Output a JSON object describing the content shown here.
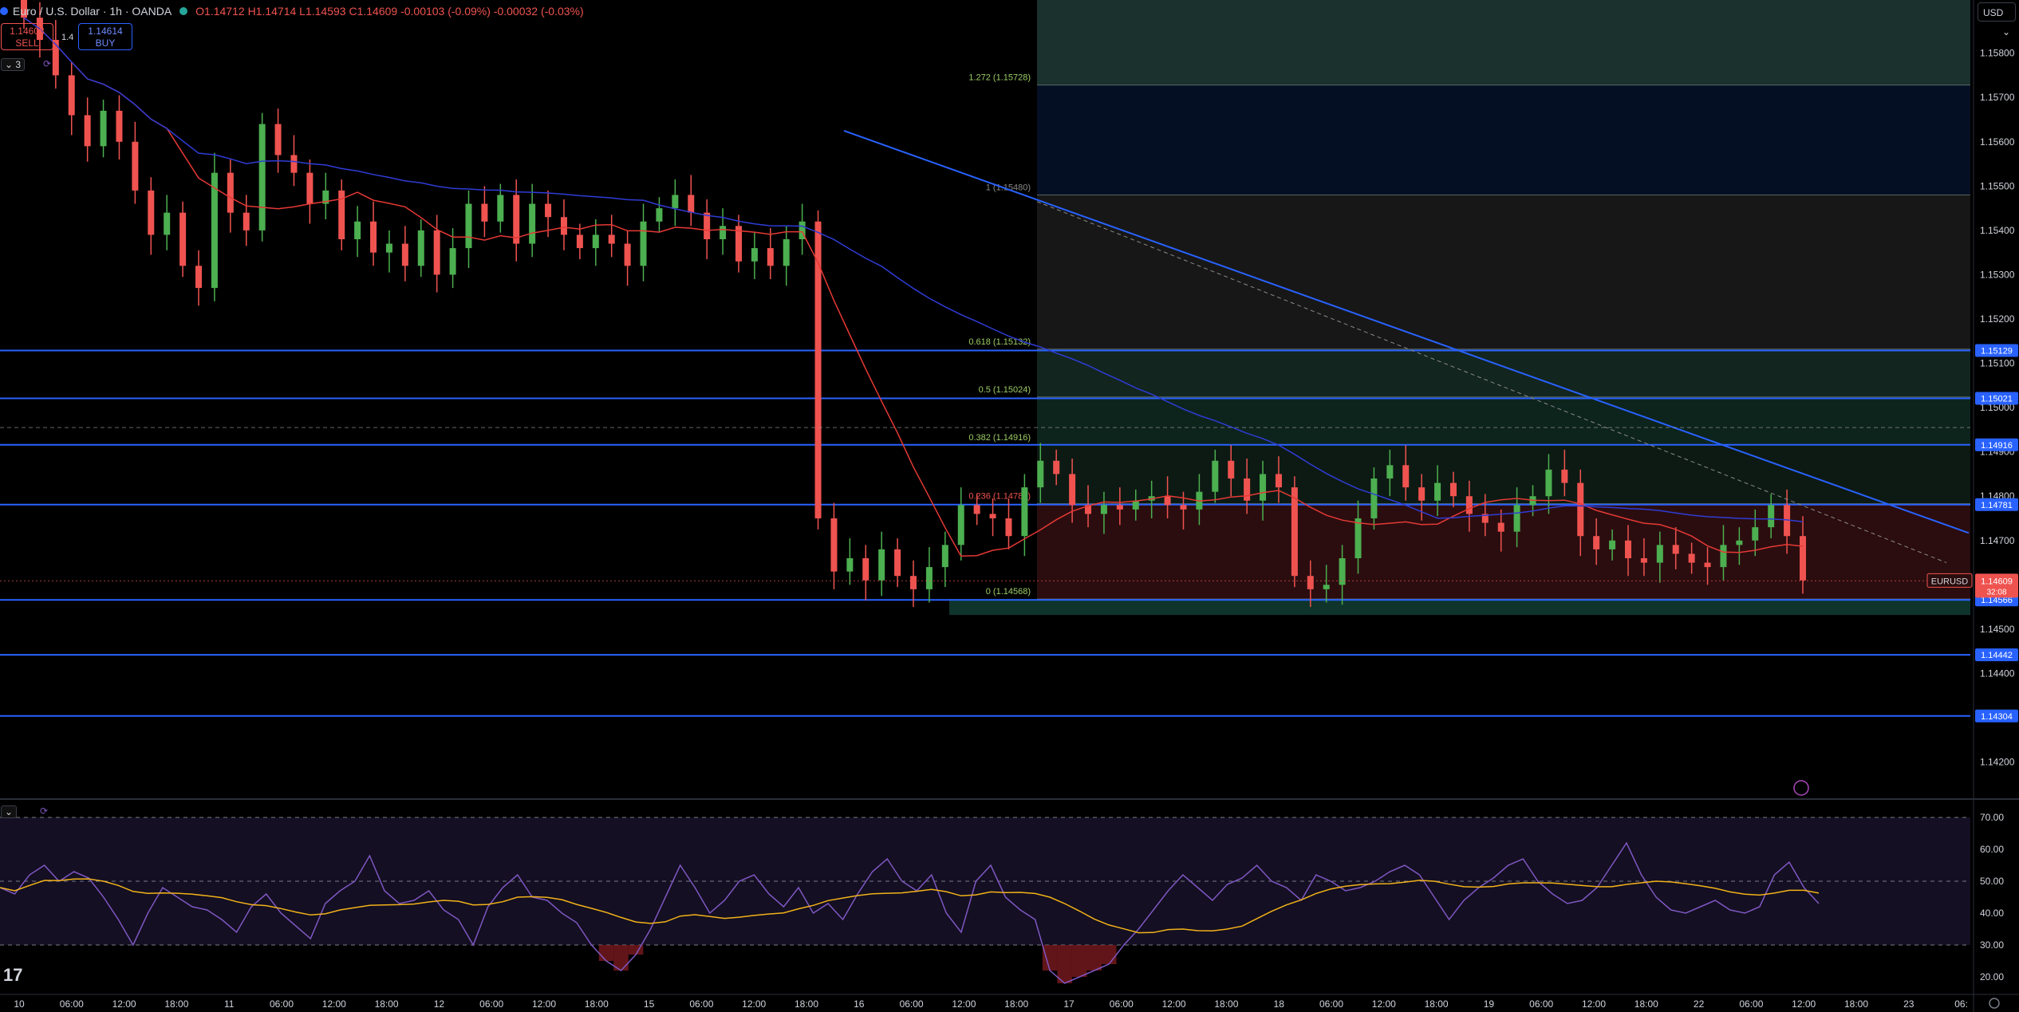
{
  "header": {
    "symbol": "Euro / U.S. Dollar · 1h · OANDA",
    "open": "O1.14712",
    "high": "H1.14714",
    "low": "L1.14593",
    "close": "C1.14609",
    "change": "-0.00103 (-0.09%)",
    "change2": "-0.00032 (-0.03%)",
    "sell_price": "1.14608",
    "sell_label": "SELL",
    "spread": "1.4",
    "buy_price": "1.14614",
    "buy_label": "BUY",
    "indicators_count": "3",
    "currency": "USD"
  },
  "colors": {
    "up": "#26a69a",
    "up_body": "#4caf50",
    "down": "#ef5350",
    "level_line": "#2962ff",
    "ma_fast": "#e53935",
    "ma_slow": "#2f3cd6",
    "rsi": "#7e57c2",
    "rsi_ma": "#f2b21a"
  },
  "chart_data": [
    {
      "type": "candlestick",
      "symbol": "EURUSD",
      "ylim": [
        1.1412,
        1.1592
      ],
      "y_ticks": [
        "1.15800",
        "1.15700",
        "1.15600",
        "1.15500",
        "1.15400",
        "1.15300",
        "1.15200",
        "1.15100",
        "1.15000",
        "1.14900",
        "1.14800",
        "1.14700",
        "1.14500",
        "1.14400",
        "1.14200"
      ],
      "x_ticks": [
        "10",
        "06:00",
        "12:00",
        "18:00",
        "11",
        "06:00",
        "12:00",
        "18:00",
        "12",
        "06:00",
        "12:00",
        "18:00",
        "15",
        "06:00",
        "12:00",
        "18:00",
        "16",
        "06:00",
        "12:00",
        "18:00",
        "17",
        "06:00",
        "12:00",
        "18:00",
        "18",
        "06:00",
        "12:00",
        "18:00",
        "19",
        "06:00",
        "12:00",
        "18:00",
        "22",
        "06:00",
        "12:00",
        "18:00",
        "23",
        "06:"
      ],
      "horizontal_levels": [
        "1.15129",
        "1.15021",
        "1.14916",
        "1.14781",
        "1.14566",
        "1.14442",
        "1.14304"
      ],
      "current_price": "1.14609",
      "current_price_label": "EURUSD",
      "countdown": "32:08",
      "fib_levels": [
        {
          "ratio": "1.272",
          "label": "1.272 (1.15728)",
          "value": 1.15728
        },
        {
          "ratio": "1",
          "label": "1 (1.15480)",
          "value": 1.1548
        },
        {
          "ratio": "0.618",
          "label": "0.618 (1.15132)",
          "value": 1.15132
        },
        {
          "ratio": "0.5",
          "label": "0.5 (1.15024)",
          "value": 1.15024
        },
        {
          "ratio": "0.382",
          "label": "0.382 (1.14916)",
          "value": 1.14916
        },
        {
          "ratio": "0.236",
          "label": "0.236 (1.14783)",
          "value": 1.14783
        },
        {
          "ratio": "0",
          "label": "0 (1.14568)",
          "value": 1.14568
        }
      ],
      "candles_close": [
        1.1588,
        1.1583,
        1.1575,
        1.1566,
        1.1559,
        1.1567,
        1.156,
        1.1549,
        1.1539,
        1.1544,
        1.1532,
        1.1527,
        1.1553,
        1.1544,
        1.154,
        1.1564,
        1.1557,
        1.1553,
        1.1546,
        1.1549,
        1.1538,
        1.1542,
        1.1535,
        1.1537,
        1.1532,
        1.154,
        1.153,
        1.1536,
        1.1546,
        1.1542,
        1.1548,
        1.1537,
        1.1546,
        1.1543,
        1.1539,
        1.1536,
        1.1539,
        1.1537,
        1.1532,
        1.1542,
        1.1545,
        1.1548,
        1.1544,
        1.1538,
        1.1541,
        1.1533,
        1.1536,
        1.1532,
        1.1538,
        1.1542,
        1.1475,
        1.1463,
        1.1466,
        1.1461,
        1.1468,
        1.1462,
        1.1459,
        1.1464,
        1.1469,
        1.1478,
        1.1476,
        1.1475,
        1.1471,
        1.1482,
        1.1488,
        1.1485,
        1.1478,
        1.1476,
        1.1478,
        1.1477,
        1.1479,
        1.148,
        1.1478,
        1.1477,
        1.1481,
        1.1488,
        1.1484,
        1.1479,
        1.1485,
        1.1482,
        1.1462,
        1.1459,
        1.146,
        1.1466,
        1.1475,
        1.1484,
        1.1487,
        1.1482,
        1.1479,
        1.1483,
        1.148,
        1.1476,
        1.1474,
        1.1472,
        1.1478,
        1.148,
        1.1486,
        1.1483,
        1.1471,
        1.1468,
        1.147,
        1.1466,
        1.1465,
        1.1469,
        1.1467,
        1.1465,
        1.1464,
        1.1469,
        1.147,
        1.1473,
        1.1478,
        1.1471,
        1.1461
      ],
      "rsi": {
        "ylim": [
          15,
          75
        ],
        "y_ticks": [
          "70.00",
          "60.00",
          "50.00",
          "40.00",
          "30.00",
          "20.00"
        ],
        "bands": [
          70,
          50,
          30
        ],
        "values": [
          48,
          46,
          52,
          55,
          50,
          53,
          51,
          45,
          38,
          30,
          40,
          48,
          45,
          42,
          41,
          38,
          34,
          42,
          46,
          40,
          36,
          32,
          43,
          47,
          50,
          58,
          47,
          43,
          44,
          47,
          41,
          38,
          30,
          42,
          48,
          52,
          45,
          44,
          40,
          37,
          30,
          25,
          22,
          27,
          35,
          45,
          55,
          48,
          40,
          44,
          50,
          52,
          46,
          42,
          48,
          40,
          43,
          38,
          46,
          53,
          57,
          50,
          47,
          52,
          40,
          34,
          50,
          55,
          45,
          41,
          38,
          22,
          18,
          20,
          22,
          24,
          30,
          35,
          41,
          47,
          52,
          48,
          44,
          49,
          51,
          55,
          50,
          48,
          44,
          52,
          50,
          47,
          48,
          50,
          53,
          55,
          52,
          45,
          38,
          44,
          48,
          51,
          55,
          57,
          50,
          46,
          43,
          44,
          48,
          55,
          62,
          52,
          45,
          41,
          40,
          42,
          44,
          41,
          40,
          42,
          52,
          56,
          48,
          43
        ]
      }
    }
  ]
}
